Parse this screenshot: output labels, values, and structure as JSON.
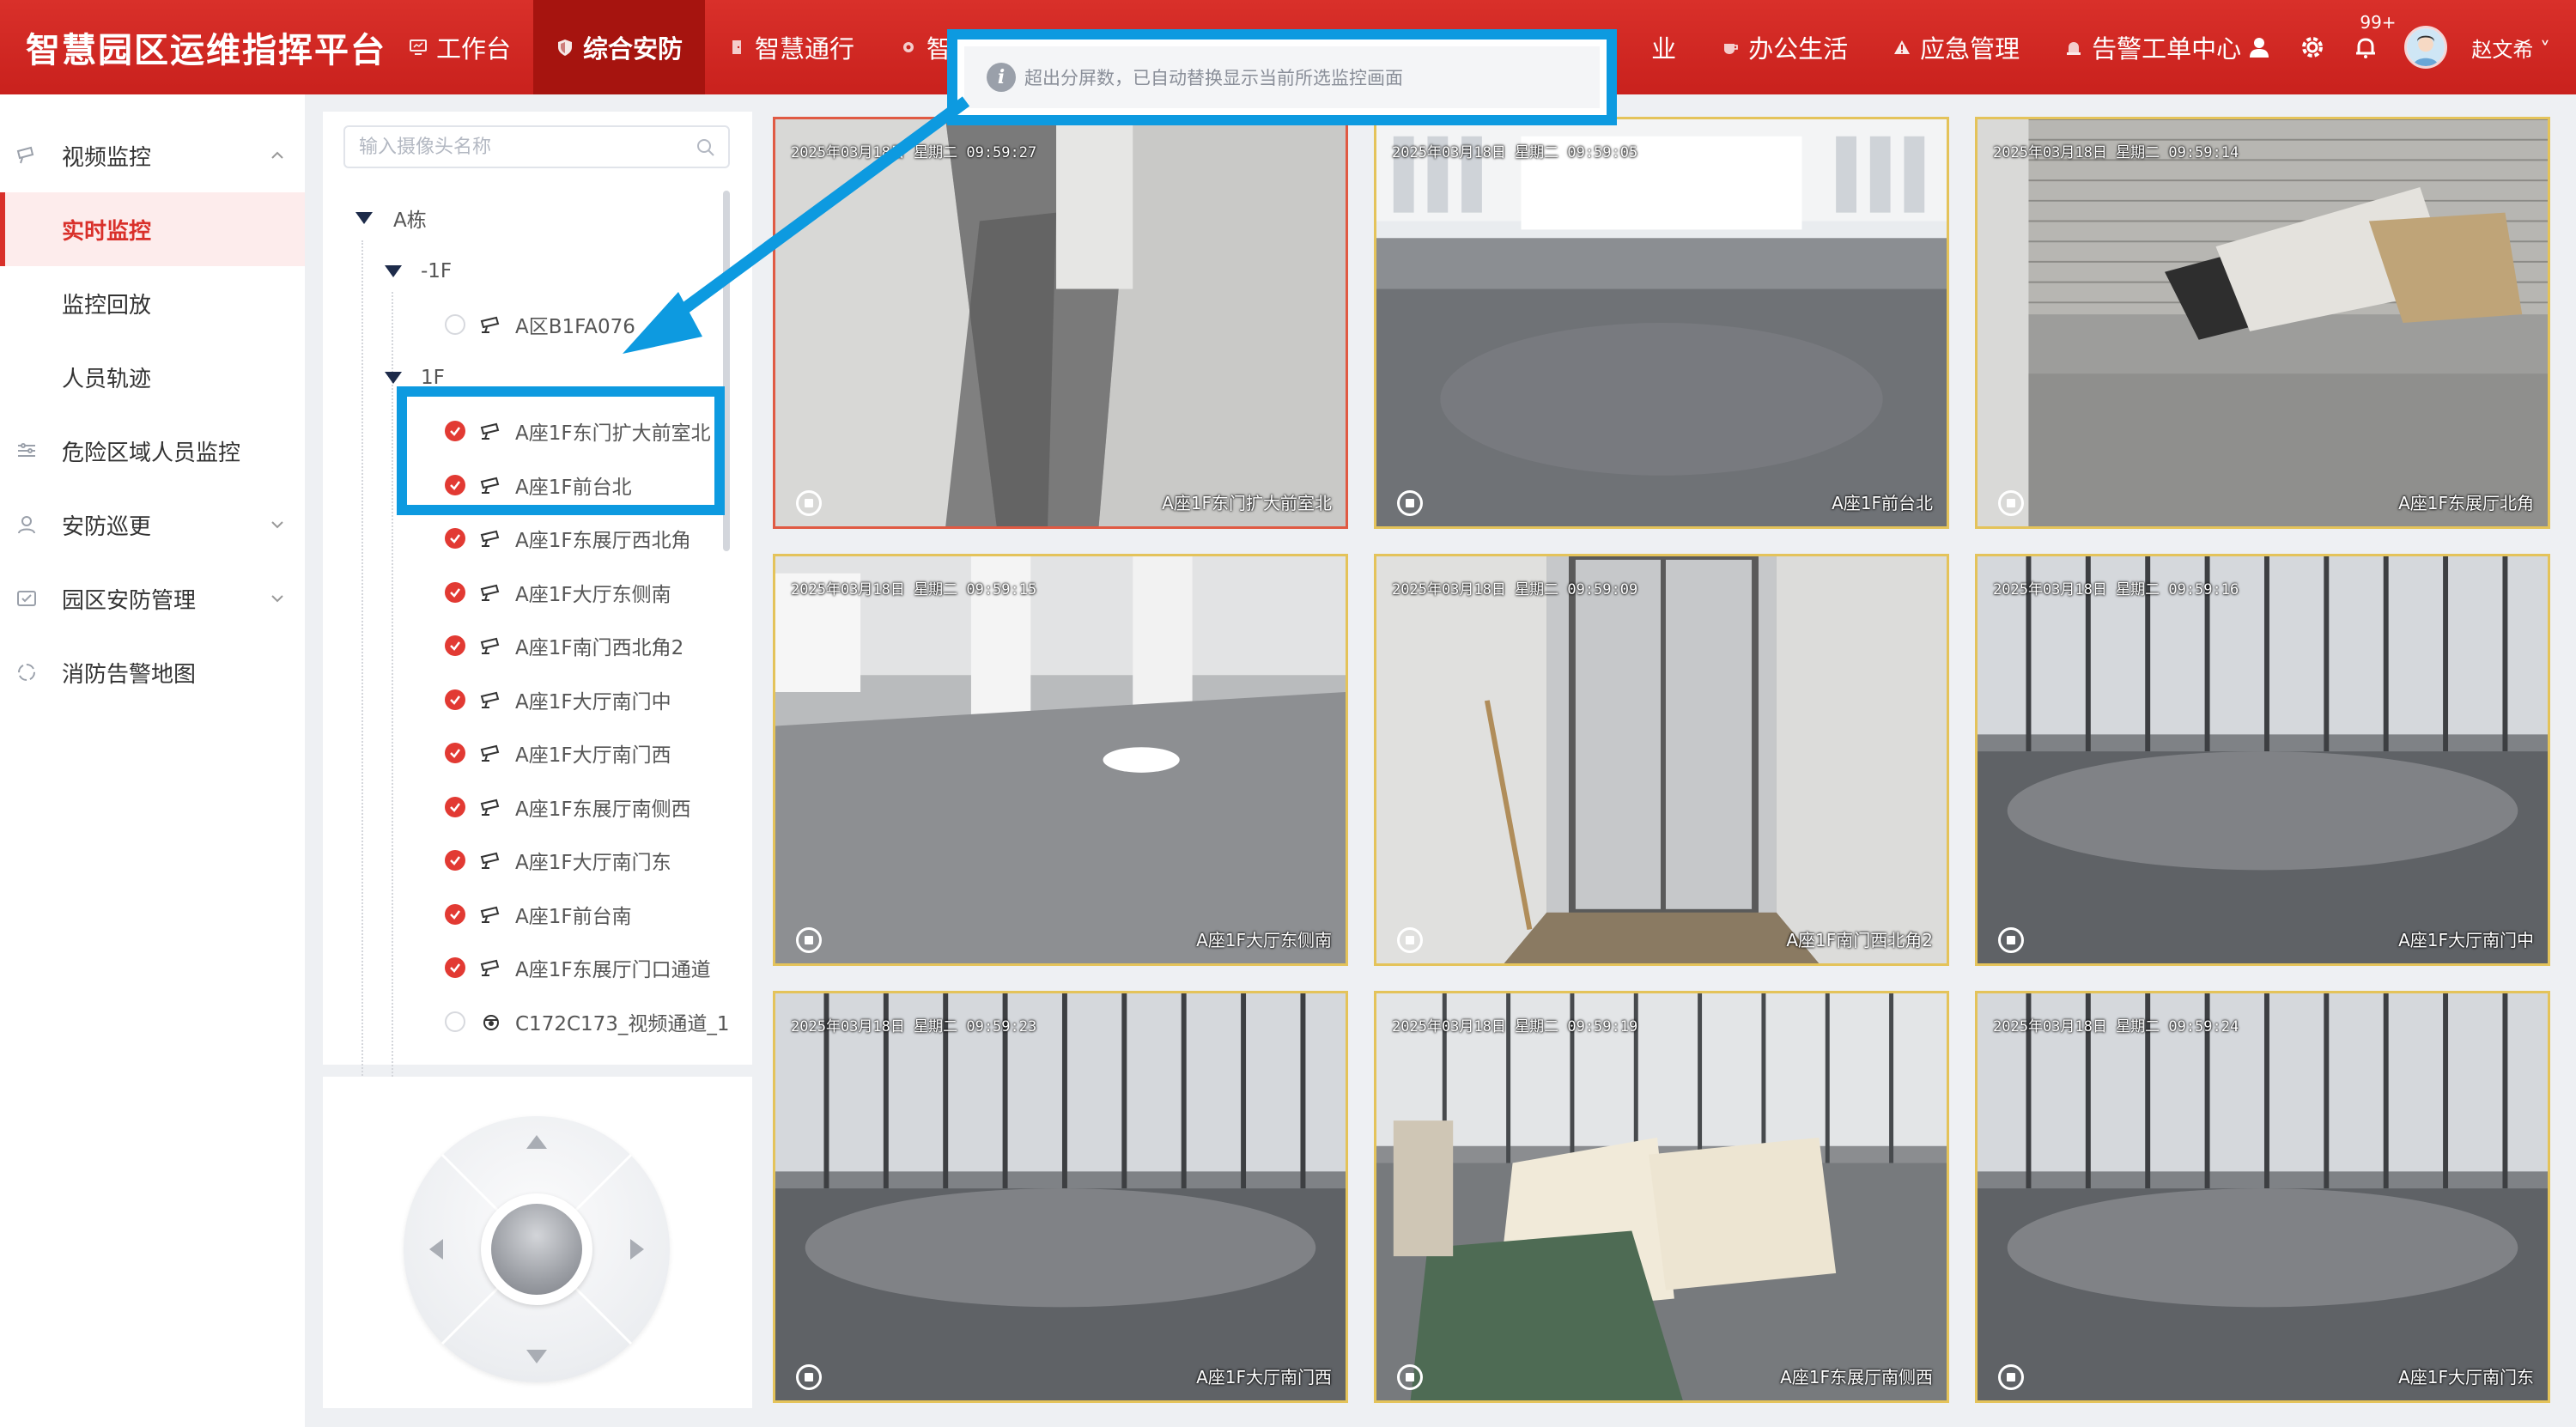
{
  "header": {
    "app_title": "智慧园区运维指挥平台",
    "nav": [
      {
        "label": "工作台",
        "icon": "monitor-icon"
      },
      {
        "label": "综合安防",
        "icon": "shield-icon",
        "active": true
      },
      {
        "label": "智慧通行",
        "icon": "door-icon"
      },
      {
        "label": "智慧",
        "icon": "gear-small-icon"
      },
      {
        "label": "业",
        "icon": ""
      },
      {
        "label": "办公生活",
        "icon": "cup-icon"
      },
      {
        "label": "应急管理",
        "icon": "warning-icon"
      },
      {
        "label": "告警工单中心",
        "icon": "alarm-icon"
      }
    ],
    "notification_count": "99+",
    "username": "赵文希 ˅"
  },
  "toast": {
    "message": "超出分屏数，已自动替换显示当前所选监控画面"
  },
  "sidebar": {
    "items": [
      {
        "label": "视频监控",
        "icon": "video-icon",
        "arrow": "up",
        "level": 1
      },
      {
        "label": "实时监控",
        "level": 2,
        "active": true
      },
      {
        "label": "监控回放",
        "level": 2
      },
      {
        "label": "人员轨迹",
        "level": 2
      },
      {
        "label": "危险区域人员监控",
        "icon": "sliders-icon",
        "level": 1
      },
      {
        "label": "安防巡更",
        "icon": "patrol-icon",
        "arrow": "down",
        "level": 1
      },
      {
        "label": "园区安防管理",
        "icon": "manage-icon",
        "arrow": "down",
        "level": 1
      },
      {
        "label": "消防告警地图",
        "icon": "map-icon",
        "level": 1
      }
    ]
  },
  "tree": {
    "search_placeholder": "输入摄像头名称",
    "building": "A栋",
    "floor_b1": "-1F",
    "floor_1": "1F",
    "cameras": [
      {
        "name": "A区B1FA076",
        "checked": false,
        "type": "bullet"
      },
      {
        "name": "A座1F东门扩大前室北",
        "checked": true,
        "type": "bullet"
      },
      {
        "name": "A座1F前台北",
        "checked": true,
        "type": "bullet"
      },
      {
        "name": "A座1F东展厅西北角",
        "checked": true,
        "type": "bullet"
      },
      {
        "name": "A座1F大厅东侧南",
        "checked": true,
        "type": "bullet"
      },
      {
        "name": "A座1F南门西北角2",
        "checked": true,
        "type": "bullet"
      },
      {
        "name": "A座1F大厅南门中",
        "checked": true,
        "type": "bullet"
      },
      {
        "name": "A座1F大厅南门西",
        "checked": true,
        "type": "bullet"
      },
      {
        "name": "A座1F东展厅南侧西",
        "checked": true,
        "type": "bullet"
      },
      {
        "name": "A座1F大厅南门东",
        "checked": true,
        "type": "bullet"
      },
      {
        "name": "A座1F前台南",
        "checked": true,
        "type": "bullet"
      },
      {
        "name": "A座1F东展厅门口通道",
        "checked": true,
        "type": "bullet"
      },
      {
        "name": "C172C173_视频通道_1",
        "checked": false,
        "type": "dome"
      }
    ]
  },
  "videos": [
    {
      "timestamp": "2025年03月18日 星期二 09:59:27",
      "label": "A座1F东门扩大前室北",
      "selected": true,
      "scene": "corridor"
    },
    {
      "timestamp": "2025年03月18日 星期二 09:59:05",
      "label": "A座1F前台北",
      "scene": "lobby"
    },
    {
      "timestamp": "2025年03月18日 星期二 09:59:14",
      "label": "A座1F东展厅西北角",
      "scene": "construction"
    },
    {
      "timestamp": "2025年03月18日 星期二 09:59:15",
      "label": "A座1F东展厅西北角",
      "scene": "hall"
    },
    {
      "timestamp": "2025年03月18日 星期二 09:59:09",
      "label": "A座1F大厅东侧南",
      "scene": "door"
    },
    {
      "timestamp": "2025年03月18日 星期二 09:59:16",
      "label": "A座1F南门西北角2",
      "scene": "glass"
    },
    {
      "timestamp": "2025年03月18日 星期二 09:59:23",
      "label": "A座1F大厅南门西",
      "scene": "glass"
    },
    {
      "timestamp": "2025年03月18日 星期二 09:59:19",
      "label": "A座1F东展厅南侧西",
      "scene": "materials"
    },
    {
      "timestamp": "2025年03月18日 星期二 09:59:24",
      "label": "A座1F大厅南门东",
      "scene": "glass"
    }
  ],
  "video_labels_shown": [
    "A座1F东门扩大前室北",
    "A座1F前台北",
    "A座1F东展厅北角",
    "A座1F大厅东侧南",
    "A座1F南门西北角2",
    "A座1F大厅南门中",
    "A座1F大厅南门西",
    "A座1F东展厅南侧西",
    "A座1F大厅南门东"
  ],
  "colors": {
    "brand_red": "#d9302a",
    "annotation_blue": "#0d9ae0",
    "video_border": "#e4c35a",
    "check_red": "#e23a33"
  }
}
